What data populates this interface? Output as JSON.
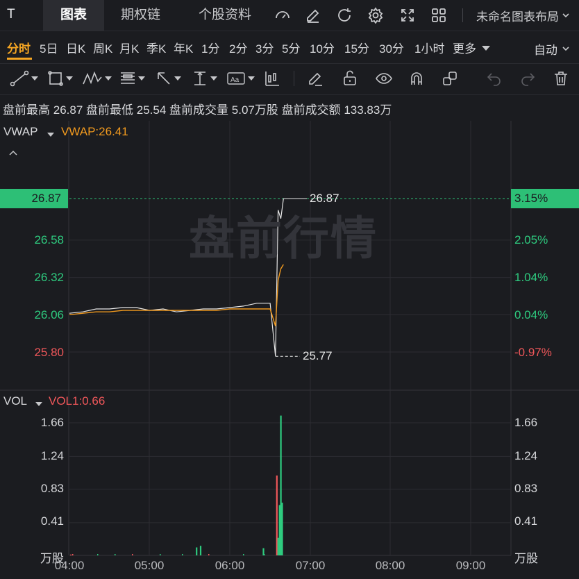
{
  "header": {
    "symbol": "T",
    "tabs": [
      "图表",
      "期权链",
      "个股资料"
    ],
    "active_tab": "图表",
    "icons": [
      "gauge-icon",
      "pencil-icon",
      "refresh-icon",
      "gear-icon",
      "fullscreen-icon",
      "grid-icon"
    ],
    "layout_name": "未命名图表布局"
  },
  "periods": {
    "items": [
      "分时",
      "5日",
      "日K",
      "周K",
      "月K",
      "季K",
      "年K",
      "1分",
      "2分",
      "3分",
      "5分",
      "10分",
      "15分",
      "30分",
      "1小时",
      "更多"
    ],
    "active": "分时",
    "mode": "自动"
  },
  "toolbar": {
    "tools": [
      "trend-line-icon",
      "rectangle-icon",
      "pattern-icon",
      "fib-icon",
      "arrow-icon",
      "measure-icon",
      "text-icon",
      "candle-icon",
      "edit-icon",
      "unlock-icon",
      "eye-icon",
      "magnet-icon",
      "link-icon",
      "undo-icon",
      "redo-icon",
      "delete-icon"
    ]
  },
  "summary": {
    "high_label": "盘前最高",
    "high_value": "26.87",
    "low_label": "盘前最低",
    "low_value": "25.54",
    "vol_label": "盘前成交量",
    "vol_value": "5.07万股",
    "amt_label": "盘前成交额",
    "amt_value": "133.83万"
  },
  "price_pane": {
    "indicator": "VWAP",
    "indicator_value": "VWAP:26.41",
    "watermark": "盘前行情",
    "current_price": "26.87",
    "current_pct": "3.15%",
    "left_ticks": [
      "26.58",
      "26.32",
      "26.06",
      "25.80"
    ],
    "right_ticks": [
      "2.05%",
      "1.04%",
      "0.04%",
      "-0.97%"
    ],
    "high_marker": "26.87",
    "low_marker": "25.77",
    "colors": {
      "up": "#2ecb7f",
      "down": "#f0575a",
      "vwap": "#f29a1e",
      "price": "#e6e6e6",
      "highlight": "#2dbf76"
    }
  },
  "volume_pane": {
    "indicator": "VOL",
    "indicator_value": "VOL1:0.66",
    "left_ticks": [
      "1.66",
      "1.24",
      "0.83",
      "0.41"
    ],
    "right_ticks": [
      "1.66",
      "1.24",
      "0.83",
      "0.41"
    ],
    "unit": "万股"
  },
  "x_axis": [
    "04:00",
    "05:00",
    "06:00",
    "07:00",
    "08:00",
    "09:00"
  ],
  "chart_data": {
    "type": "line",
    "title": "",
    "x": [
      "04:00",
      "04:10",
      "04:20",
      "04:30",
      "04:40",
      "04:50",
      "05:00",
      "05:10",
      "05:20",
      "05:30",
      "05:40",
      "05:50",
      "06:00",
      "06:10",
      "06:20",
      "06:30",
      "06:34",
      "06:36",
      "06:38",
      "06:40"
    ],
    "series": [
      {
        "values": [
          26.07,
          26.08,
          26.1,
          26.1,
          26.11,
          26.11,
          26.09,
          26.1,
          26.08,
          26.09,
          26.1,
          26.1,
          26.11,
          26.12,
          26.14,
          26.14,
          25.77,
          26.79,
          26.73,
          26.87
        ]
      },
      {
        "name": "VWAP",
        "values": [
          26.06,
          26.07,
          26.08,
          26.08,
          26.09,
          26.09,
          26.09,
          26.09,
          26.09,
          26.09,
          26.09,
          26.09,
          26.1,
          26.1,
          26.1,
          26.1,
          25.98,
          26.3,
          26.38,
          26.41
        ]
      }
    ],
    "volume": {
      "unit": "万股",
      "x": [
        "04:01",
        "05:35",
        "05:38",
        "06:25",
        "06:35",
        "06:36",
        "06:37",
        "06:38",
        "06:39"
      ],
      "values": [
        0.01,
        0.1,
        0.12,
        0.09,
        1.0,
        0.22,
        0.63,
        1.75,
        0.66
      ],
      "colors": [
        "down",
        "up",
        "up",
        "up",
        "down",
        "up",
        "up",
        "up",
        "up"
      ]
    },
    "ylim": [
      25.7,
      27.05
    ],
    "vol_ylim": [
      0,
      1.9
    ]
  }
}
